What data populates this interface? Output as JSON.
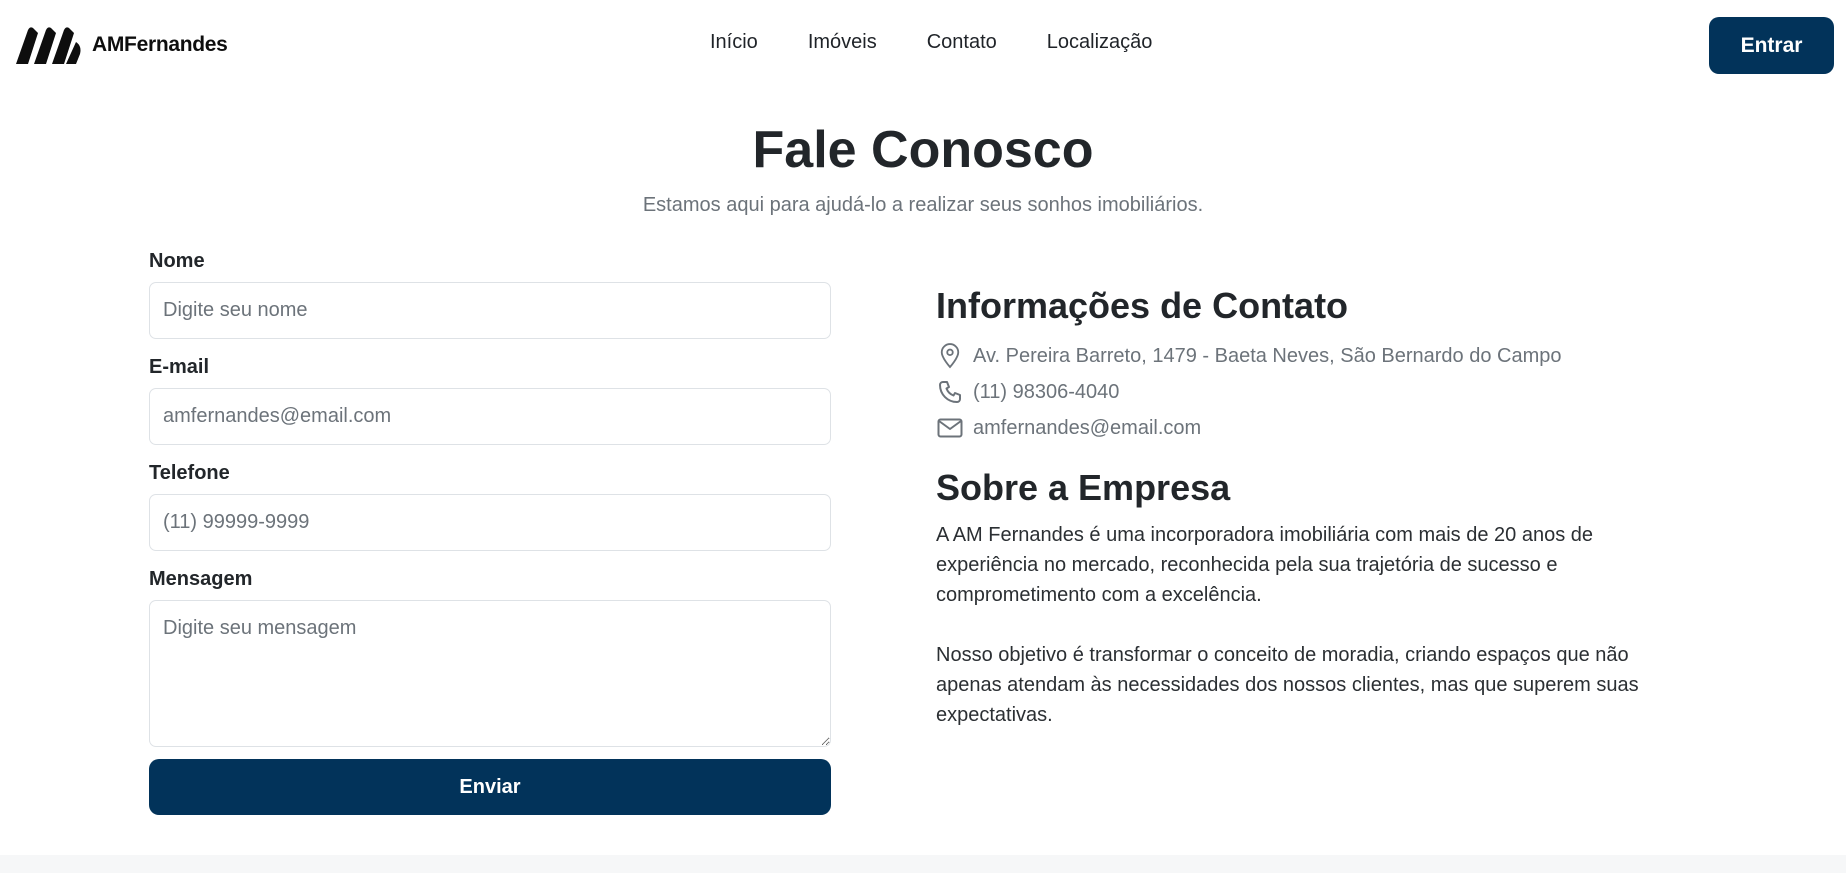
{
  "brand": {
    "name": "AMFernandes",
    "primary_color": "#02335a"
  },
  "nav": {
    "items": [
      {
        "label": "Início"
      },
      {
        "label": "Imóveis"
      },
      {
        "label": "Contato"
      },
      {
        "label": "Localização"
      }
    ],
    "login_label": "Entrar"
  },
  "hero": {
    "title": "Fale Conosco",
    "subtitle": "Estamos aqui para ajudá-lo a realizar seus sonhos imobiliários."
  },
  "form": {
    "name": {
      "label": "Nome",
      "placeholder": "Digite seu nome"
    },
    "email": {
      "label": "E-mail",
      "placeholder": "amfernandes@email.com"
    },
    "phone": {
      "label": "Telefone",
      "placeholder": "(11) 99999-9999"
    },
    "message": {
      "label": "Mensagem",
      "placeholder": "Digite seu mensagem"
    },
    "submit_label": "Enviar"
  },
  "contact": {
    "title": "Informações de Contato",
    "address": "Av. Pereira Barreto, 1479 - Baeta Neves, São Bernardo do Campo",
    "phone": "(11) 98306-4040",
    "email": "amfernandes@email.com",
    "icons": [
      "map-pin-icon",
      "phone-icon",
      "mail-icon"
    ]
  },
  "about": {
    "title": "Sobre a Empresa",
    "paragraph_1": "A AM Fernandes é uma incorporadora imobiliária com mais de 20 anos de experiência no mercado, reconhecida pela sua trajetória de sucesso e comprometimento com a excelência.",
    "paragraph_2": "Nosso objetivo é transformar o conceito de moradia, criando espaços que não apenas atendam às necessidades dos nossos clientes, mas que superem suas expectativas."
  }
}
